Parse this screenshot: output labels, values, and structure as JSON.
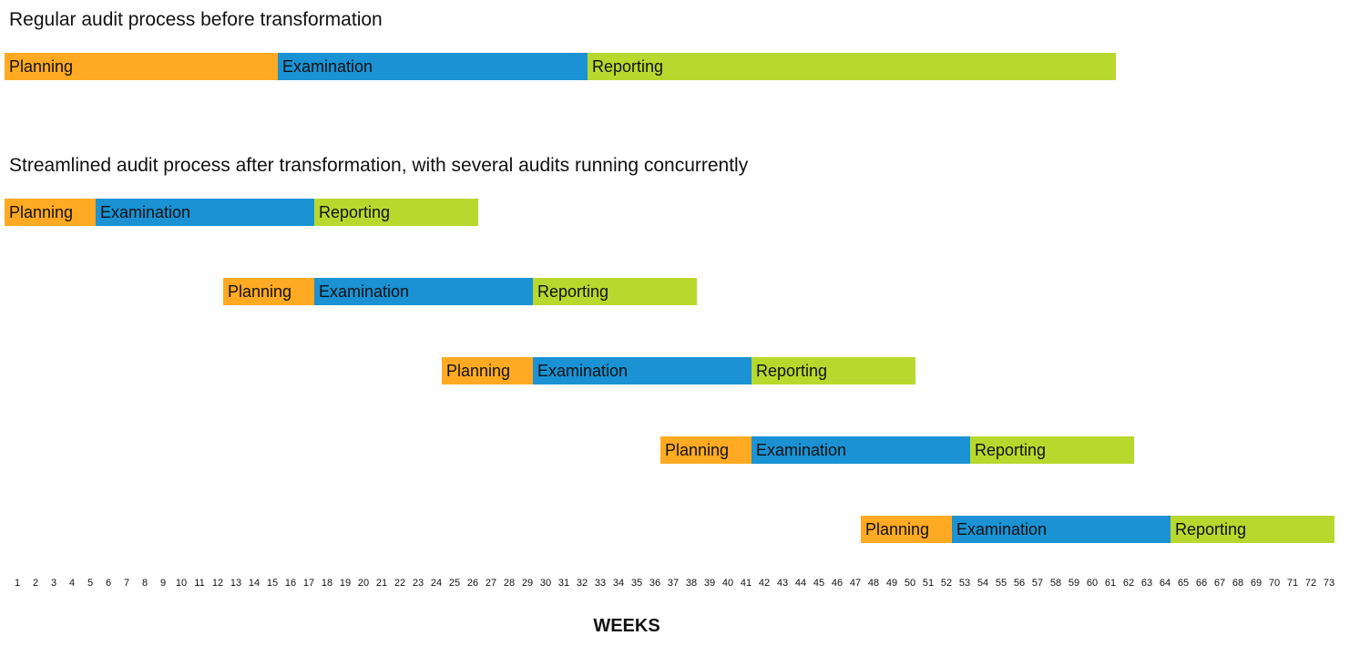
{
  "chart_data": {
    "type": "gantt",
    "xlabel": "WEEKS",
    "x_ticks": [
      1,
      2,
      3,
      4,
      5,
      6,
      7,
      8,
      9,
      10,
      11,
      12,
      13,
      14,
      15,
      16,
      17,
      18,
      19,
      20,
      21,
      22,
      23,
      24,
      25,
      26,
      27,
      28,
      29,
      30,
      31,
      32,
      33,
      34,
      35,
      36,
      37,
      38,
      39,
      40,
      41,
      42,
      43,
      44,
      45,
      46,
      47,
      48,
      49,
      50,
      51,
      52,
      53,
      54,
      55,
      56,
      57,
      58,
      59,
      60,
      61,
      62,
      63,
      64,
      65,
      66,
      67,
      68,
      69,
      70,
      71,
      72,
      73
    ],
    "xlim": [
      1,
      73
    ],
    "phase_colors": {
      "Planning": "#FFAA22",
      "Examination": "#1A92D3",
      "Reporting": "#B8D82E"
    },
    "groups": [
      {
        "title": "Regular audit process before transformation",
        "audits": [
          {
            "phases": [
              {
                "label": "Planning",
                "start_week": 1,
                "duration_weeks": 15
              },
              {
                "label": "Examination",
                "start_week": 16,
                "duration_weeks": 17
              },
              {
                "label": "Reporting",
                "start_week": 33,
                "duration_weeks": 29
              }
            ]
          }
        ]
      },
      {
        "title": "Streamlined audit process after transformation, with several audits running concurrently",
        "audits": [
          {
            "phases": [
              {
                "label": "Planning",
                "start_week": 1,
                "duration_weeks": 5
              },
              {
                "label": "Examination",
                "start_week": 6,
                "duration_weeks": 12
              },
              {
                "label": "Reporting",
                "start_week": 18,
                "duration_weeks": 9
              }
            ]
          },
          {
            "phases": [
              {
                "label": "Planning",
                "start_week": 13,
                "duration_weeks": 5
              },
              {
                "label": "Examination",
                "start_week": 18,
                "duration_weeks": 12
              },
              {
                "label": "Reporting",
                "start_week": 30,
                "duration_weeks": 9
              }
            ]
          },
          {
            "phases": [
              {
                "label": "Planning",
                "start_week": 25,
                "duration_weeks": 5
              },
              {
                "label": "Examination",
                "start_week": 30,
                "duration_weeks": 12
              },
              {
                "label": "Reporting",
                "start_week": 42,
                "duration_weeks": 9
              }
            ]
          },
          {
            "phases": [
              {
                "label": "Planning",
                "start_week": 37,
                "duration_weeks": 5
              },
              {
                "label": "Examination",
                "start_week": 42,
                "duration_weeks": 12
              },
              {
                "label": "Reporting",
                "start_week": 54,
                "duration_weeks": 9
              }
            ]
          },
          {
            "phases": [
              {
                "label": "Planning",
                "start_week": 48,
                "duration_weeks": 5
              },
              {
                "label": "Examination",
                "start_week": 53,
                "duration_weeks": 12
              },
              {
                "label": "Reporting",
                "start_week": 65,
                "duration_weeks": 9
              }
            ]
          }
        ]
      }
    ]
  }
}
